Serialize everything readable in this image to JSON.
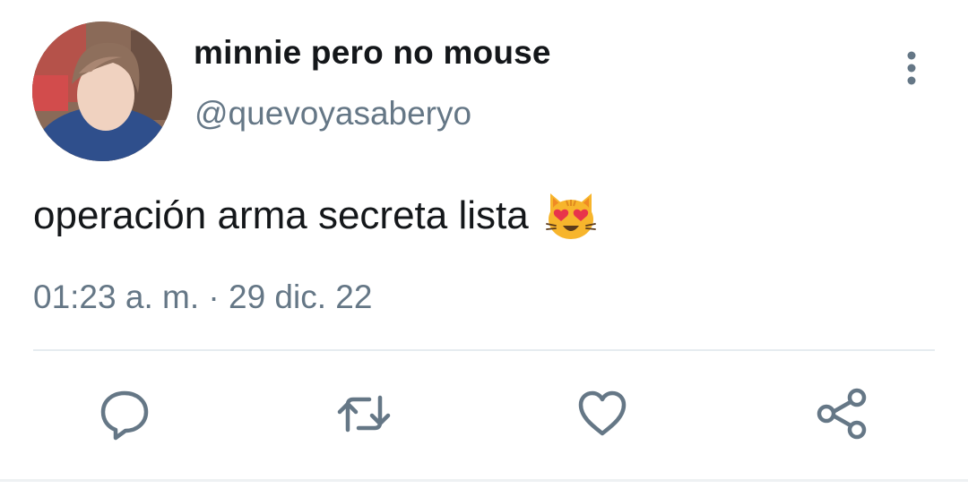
{
  "tweet": {
    "author": {
      "display_name": "minnie pero no mouse",
      "handle": "@quevoyasaberyo",
      "avatar_icon": "avatar-photo"
    },
    "text": "operación arma secreta lista",
    "emoji": "smiling-cat-with-heart-eyes",
    "timestamp": "01:23 a. m. · 29 dic. 22"
  },
  "actions": [
    {
      "name": "reply",
      "icon": "speech-bubble-icon"
    },
    {
      "name": "retweet",
      "icon": "retweet-arrows-icon"
    },
    {
      "name": "like",
      "icon": "heart-outline-icon"
    },
    {
      "name": "share",
      "icon": "share-nodes-icon"
    }
  ],
  "colors": {
    "text_primary": "#14171a",
    "text_secondary": "#657786",
    "icon_gray": "#657786",
    "divider": "#e6ecf0"
  }
}
